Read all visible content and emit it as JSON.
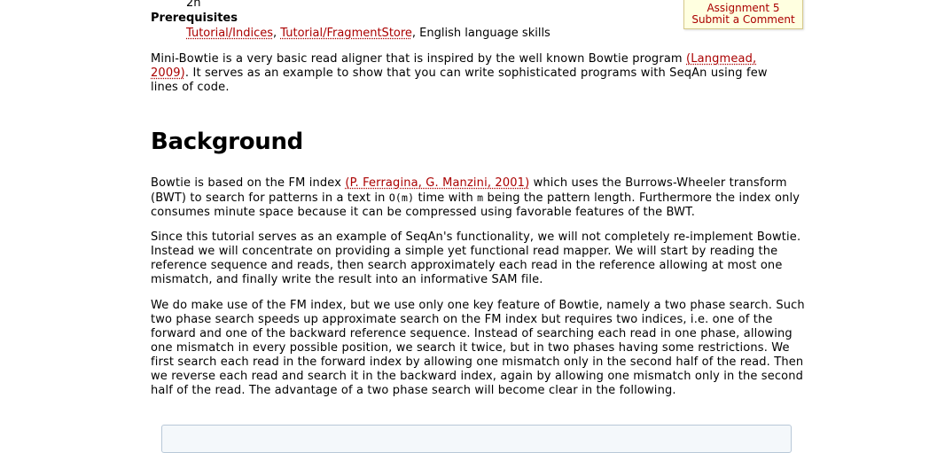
{
  "header": {
    "time": "2h",
    "prerequisites_label": "Prerequisites",
    "prereq_links": [
      "Tutorial/Indices",
      "Tutorial/FragmentStore"
    ],
    "prereq_sep": ", ",
    "prereq_tail": ", English language skills"
  },
  "sidebox": {
    "assignment": "Assignment 5",
    "comment": "Submit a Comment"
  },
  "intro": {
    "before": "Mini-Bowtie is a very basic read aligner that is inspired by the well known Bowtie program ",
    "cite": "(Langmead, 2009)",
    "after": ". It serves as an example to show that you can write sophisticated programs with SeqAn using few lines of code."
  },
  "section_title": "Background",
  "para1": {
    "a": "Bowtie is based on the FM index ",
    "cite": "(P. Ferragina, G. Manzini, 2001)",
    "b": " which uses the Burrows-Wheeler transform (BWT) to search for patterns in a text in ",
    "code1": "O(m)",
    "c": " time with ",
    "code2": "m",
    "d": " being the pattern length. Furthermore the index only consumes minute space because it can be compressed using favorable features of the BWT."
  },
  "para2": "Since this tutorial serves as an example of SeqAn's functionality, we will not completely re-implement Bowtie. Instead we will concentrate on providing a simple yet functional read mapper. We will start by reading the reference sequence and reads, then search approximately each read in the reference allowing at most one mismatch, and finally write the result into an informative SAM file.",
  "para3": "We do make use of the FM index, but we use only one key feature of Bowtie, namely a two phase search. Such two phase search speeds up approximate search on the FM index but requires two indices, i.e. one of the forward and one of the backward reference sequence. Instead of searching each read in one phase, allowing one mismatch in every possible position, we search it twice, but in two phases having some restrictions. We first search each read in the forward index by allowing one mismatch only in the second half of the read. Then we reverse each read and search it in the backward index, again by allowing one mismatch only in the second half of the read. The advantage of a two phase search will become clear in the following."
}
